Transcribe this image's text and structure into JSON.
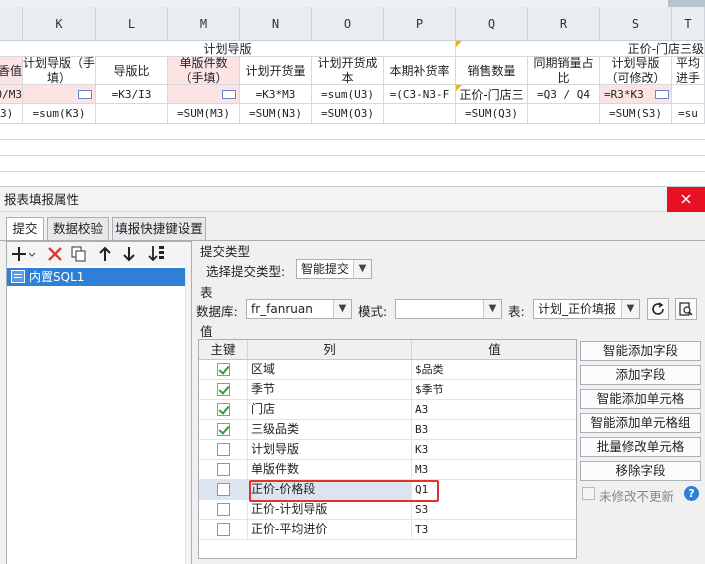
{
  "sheet": {
    "columns": [
      "K",
      "L",
      "M",
      "N",
      "O",
      "P",
      "Q",
      "R",
      "S",
      "T"
    ],
    "row1": {
      "group_left": "计划导版",
      "group_right": "正价-门店三级"
    },
    "row2": {
      "A": "香值",
      "K": "计划导版（手填）",
      "L": "导版比",
      "M": "单版件数（手填）",
      "N": "计划开货量",
      "O": "计划开货成本",
      "P": "本期补货率",
      "Q": "销售数量",
      "R": "同期销量占比",
      "S": "计划导版（可修改）",
      "T": "平均进手"
    },
    "row3": {
      "A": "0/M3",
      "L": "=K3/I3",
      "N": "=K3*M3",
      "O": "=sum(U3)",
      "P": "=(C3-N3-F",
      "Q": "正价-门店三",
      "R": "=Q3 / Q4",
      "S": "=R3*K3"
    },
    "row4": {
      "A": "3)",
      "K": "=sum(K3)",
      "M": "=SUM(M3)",
      "N": "=SUM(N3)",
      "O": "=SUM(O3)",
      "Q": "=SUM(Q3)",
      "S": "=SUM(S3)",
      "T": "=su"
    }
  },
  "dialog": {
    "title": "报表填报属性",
    "tabs": [
      "提交",
      "数据校验",
      "填报快捷键设置"
    ],
    "left_items": [
      "内置SQL1"
    ],
    "submit_type_section": "提交类型",
    "select_submit_type_label": "选择提交类型:",
    "submit_type_value": "智能提交",
    "table_section": "表",
    "database_label": "数据库:",
    "database_value": "fr_fanruan",
    "schema_label": "模式:",
    "schema_value": "",
    "table_label": "表:",
    "table_value": "计划_正价填报",
    "value_section": "值",
    "grid_headers": [
      "主键",
      "列",
      "值"
    ],
    "rows": [
      {
        "key": true,
        "column": "区域",
        "value": "$品类"
      },
      {
        "key": true,
        "column": "季节",
        "value": "$季节"
      },
      {
        "key": true,
        "column": "门店",
        "value": "A3"
      },
      {
        "key": true,
        "column": "三级品类",
        "value": "B3"
      },
      {
        "key": false,
        "column": "计划导版",
        "value": "K3"
      },
      {
        "key": false,
        "column": "单版件数",
        "value": "M3"
      },
      {
        "key": false,
        "column": "正价-价格段",
        "value": "Q1"
      },
      {
        "key": false,
        "column": "正价-计划导版",
        "value": "S3"
      },
      {
        "key": false,
        "column": "正价-平均进价",
        "value": "T3"
      }
    ],
    "buttons": [
      "智能添加字段",
      "添加字段",
      "智能添加单元格",
      "智能添加单元格组",
      "批量修改单元格",
      "移除字段"
    ],
    "no_update_label": "未修改不更新",
    "help": "?"
  }
}
